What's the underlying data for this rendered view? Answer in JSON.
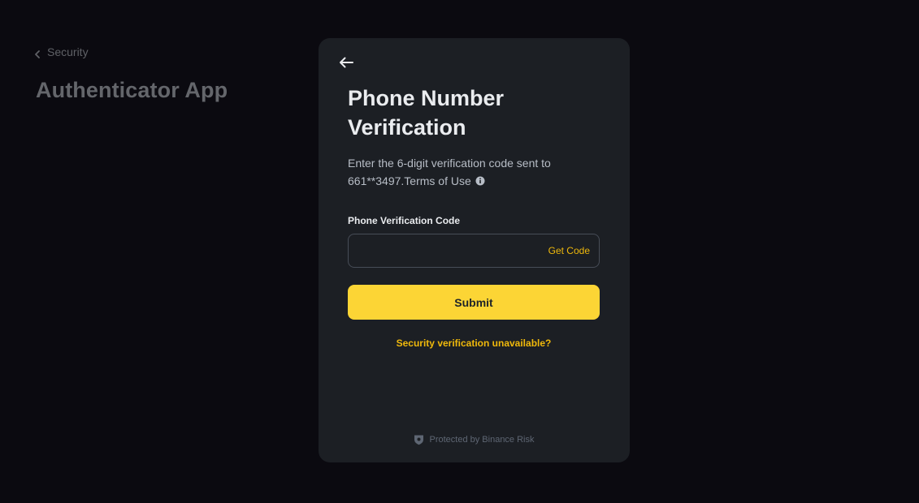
{
  "background": {
    "breadcrumb_label": "Security",
    "title": "Authenticator App"
  },
  "modal": {
    "title": "Phone Number Verification",
    "description": "Enter the 6-digit verification code sent to 661**3497.Terms of Use",
    "description_line1": "Enter the 6-digit verification code sent to",
    "description_line2": "661**3497.Terms of Use",
    "field_label": "Phone Verification Code",
    "input_value": "",
    "input_placeholder": "",
    "get_code_label": "Get Code",
    "submit_label": "Submit",
    "unavailable_link": "Security verification unavailable?",
    "protected_text": "Protected by Binance Risk"
  },
  "icons": {
    "back": "arrow-left-icon",
    "breadcrumb": "chevron-left-icon",
    "info": "info-icon",
    "shield": "shield-icon"
  },
  "colors": {
    "page_bg": "#0b0a10",
    "modal_bg": "#1c1f24",
    "accent_yellow": "#fcd535",
    "link_yellow": "#f0b90b",
    "input_border": "#474d57"
  }
}
